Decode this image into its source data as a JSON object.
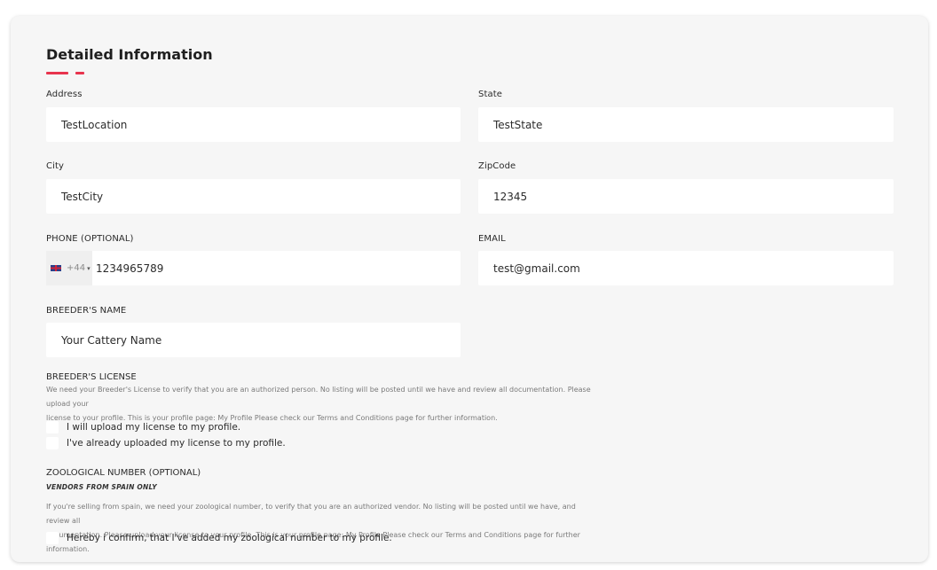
{
  "section": {
    "title": "Detailed Information"
  },
  "fields": {
    "address": {
      "label": "Address",
      "value": "TestLocation"
    },
    "state": {
      "label": "State",
      "value": "TestState"
    },
    "city": {
      "label": "City",
      "value": "TestCity"
    },
    "zipcode": {
      "label": "ZipCode",
      "value": "12345"
    },
    "phone": {
      "label": "PHONE (OPTIONAL)",
      "country_code": "+44",
      "value": "1234965789"
    },
    "email": {
      "label": "EMAIL",
      "value": "test@gmail.com"
    },
    "breeder_name": {
      "label": "BREEDER'S NAME",
      "value": "Your Cattery Name"
    }
  },
  "license": {
    "title": "BREEDER'S LICENSE",
    "desc_line1": "We need your Breeder's License to verify that you are an authorized person. No listing will be posted until we have and review all documentation. Please upload your",
    "desc_line2": "license to your profile. This is your profile page: My Profile Please check our Terms and Conditions page for further information.",
    "option1": "I will upload my license to my profile.",
    "option2": "I've already uploaded my license to my profile."
  },
  "zoological": {
    "title": "ZOOLOGICAL NUMBER (OPTIONAL)",
    "subtitle": "VENDORS FROM SPAIN ONLY",
    "desc_line1": "If you're selling from spain, we need your zoological number, to verify that you are an authorized vendor. No listing will be posted until we have, and review all",
    "desc_line2": "documentation. Please upload your license to your profile. This is your profile page: My Profile Please check our Terms and Conditions page for further information.",
    "confirm": "Hereby i confirm, that I've added my zoological number to my profile."
  },
  "colors": {
    "accent": "#e8344e",
    "card_bg": "#f6f6f6",
    "input_bg": "#ffffff"
  }
}
